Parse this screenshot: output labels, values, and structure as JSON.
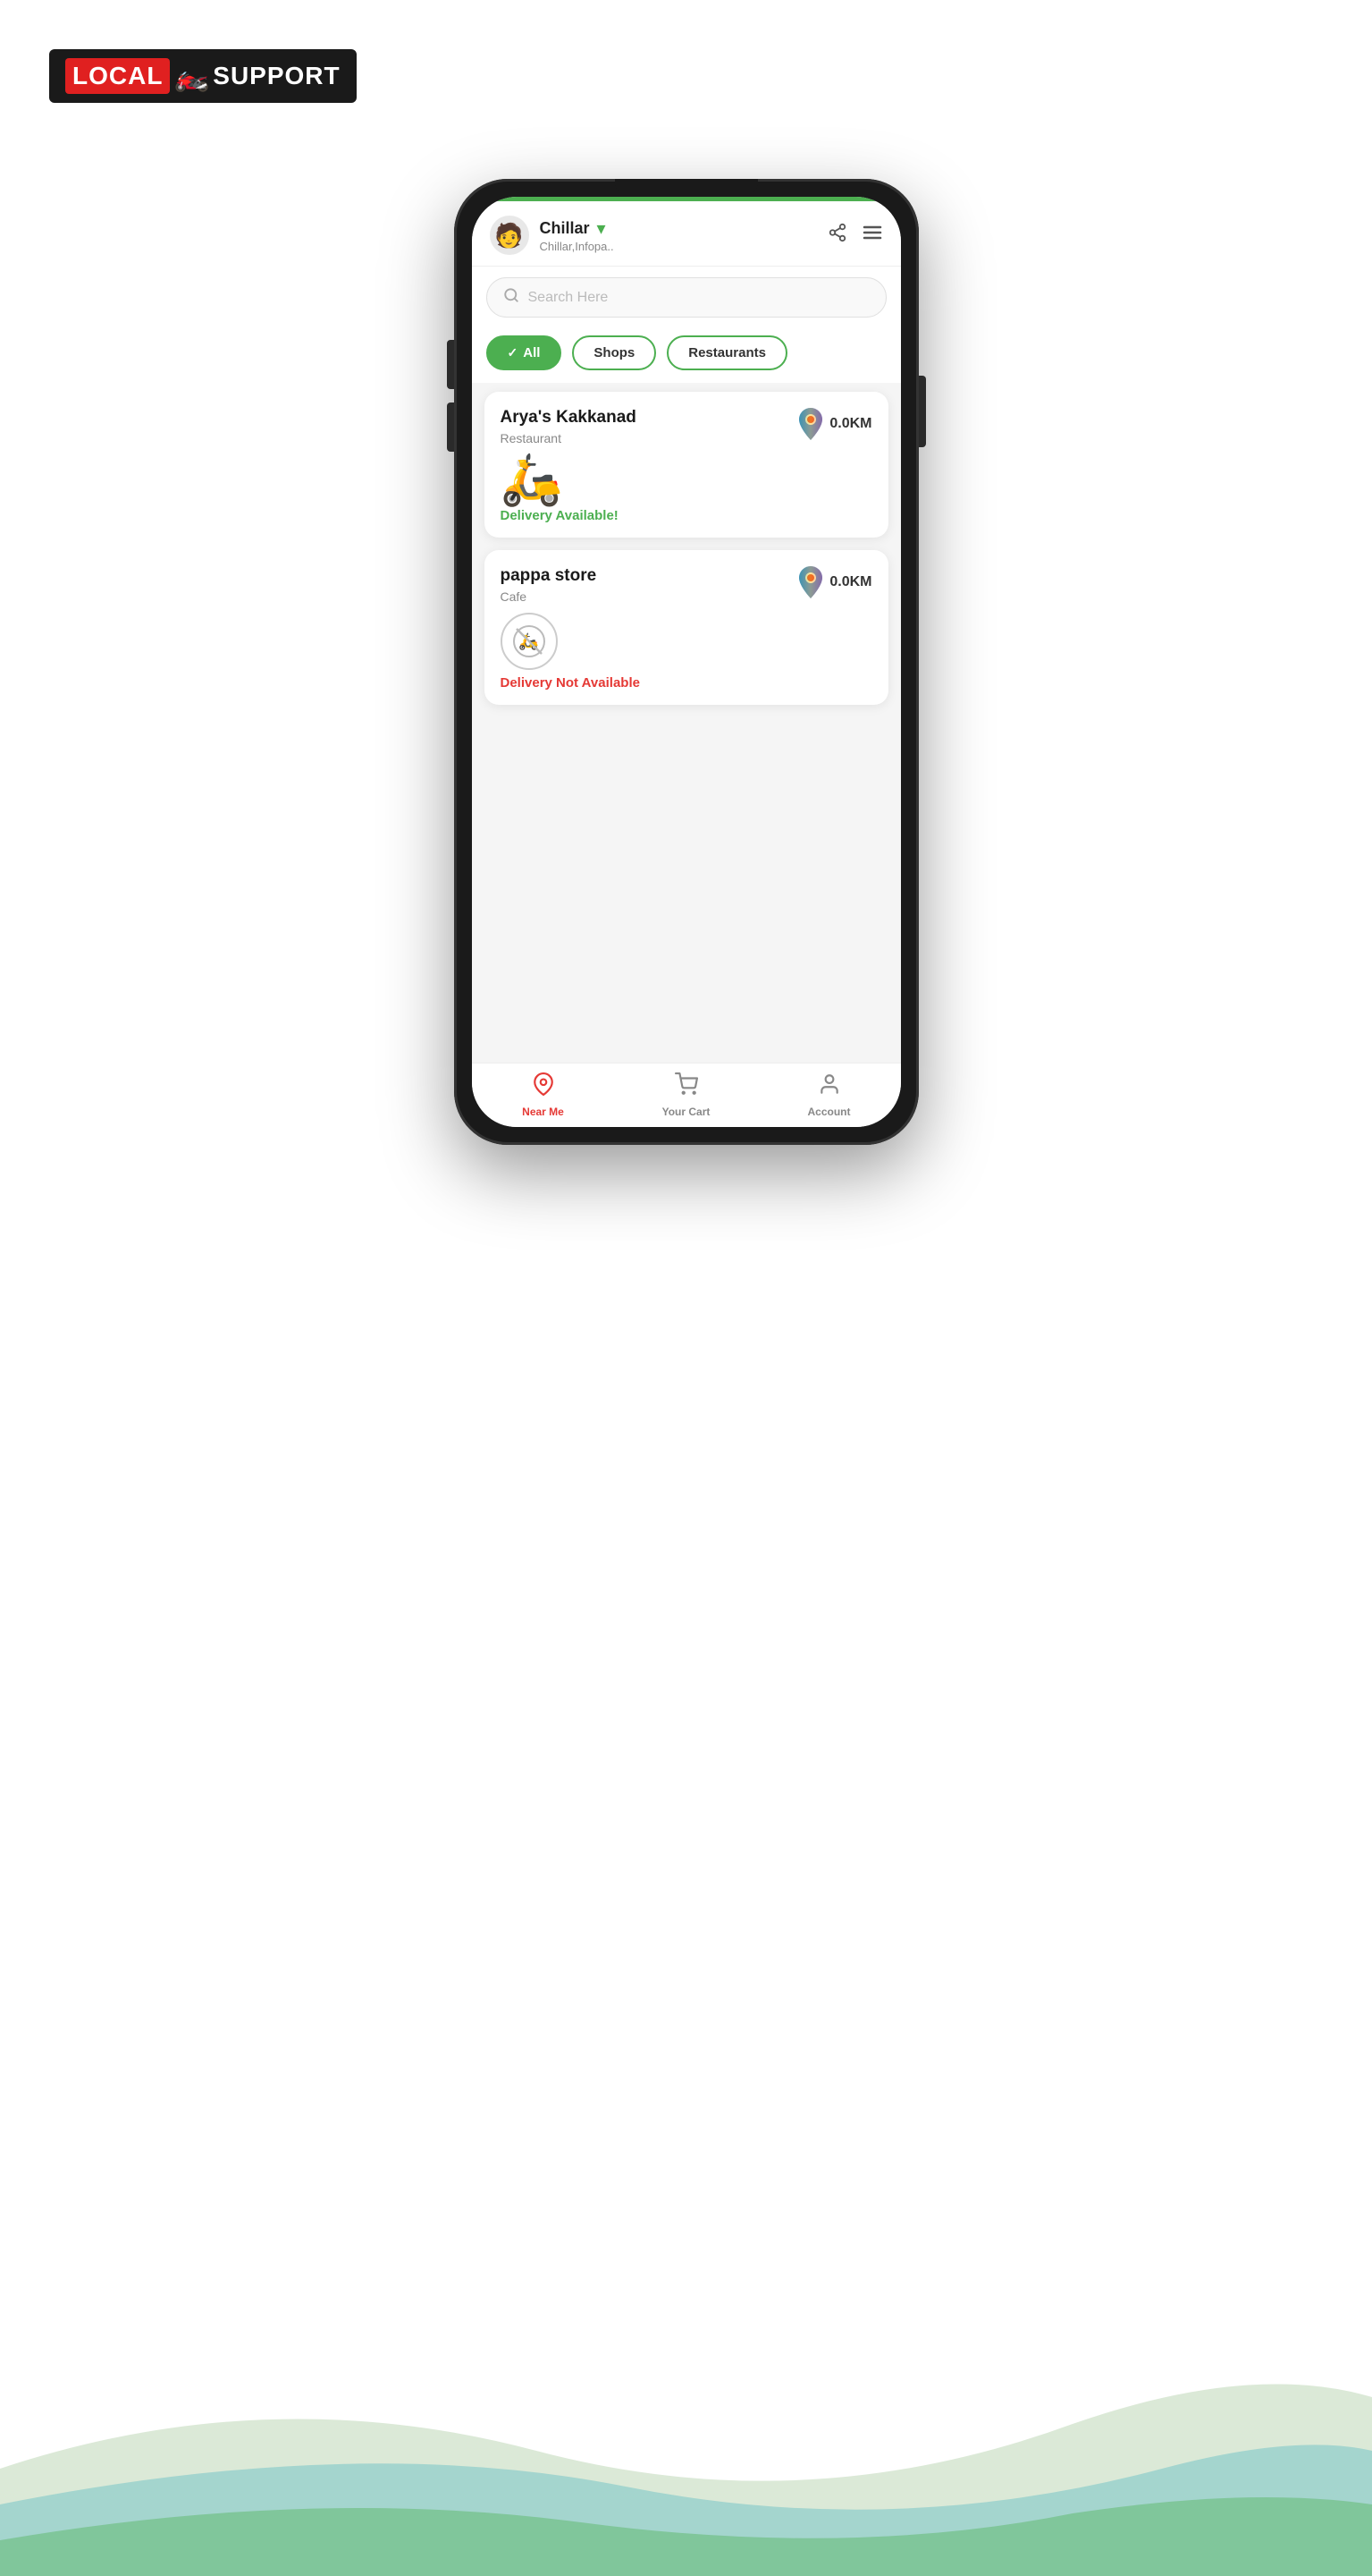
{
  "logo": {
    "red_text": "LOCAL",
    "white_text": "SUPPORT",
    "alt": "Local Support Logo"
  },
  "header": {
    "city": "Chillar",
    "address": "Chillar,Infopa..",
    "share_icon": "share",
    "menu_icon": "menu"
  },
  "search": {
    "placeholder": "Search Here"
  },
  "filters": {
    "all_label": "All",
    "shops_label": "Shops",
    "restaurants_label": "Restaurants"
  },
  "stores": [
    {
      "name": "Arya's Kakkanad",
      "type": "Restaurant",
      "distance": "0.0KM",
      "delivery_available": true,
      "delivery_text": "Delivery Available!",
      "delivery_status": "available"
    },
    {
      "name": "pappa store",
      "type": "Cafe",
      "distance": "0.0KM",
      "delivery_available": false,
      "delivery_text": "Delivery Not Available",
      "delivery_status": "unavailable"
    }
  ],
  "bottom_nav": [
    {
      "id": "near-me",
      "label": "Near Me",
      "active": true,
      "icon": "📍"
    },
    {
      "id": "your-cart",
      "label": "Your Cart",
      "active": false,
      "icon": "🛒"
    },
    {
      "id": "account",
      "label": "Account",
      "active": false,
      "icon": "👤"
    }
  ],
  "colors": {
    "green": "#4caf50",
    "red": "#e53935",
    "active_nav": "#e53935"
  }
}
